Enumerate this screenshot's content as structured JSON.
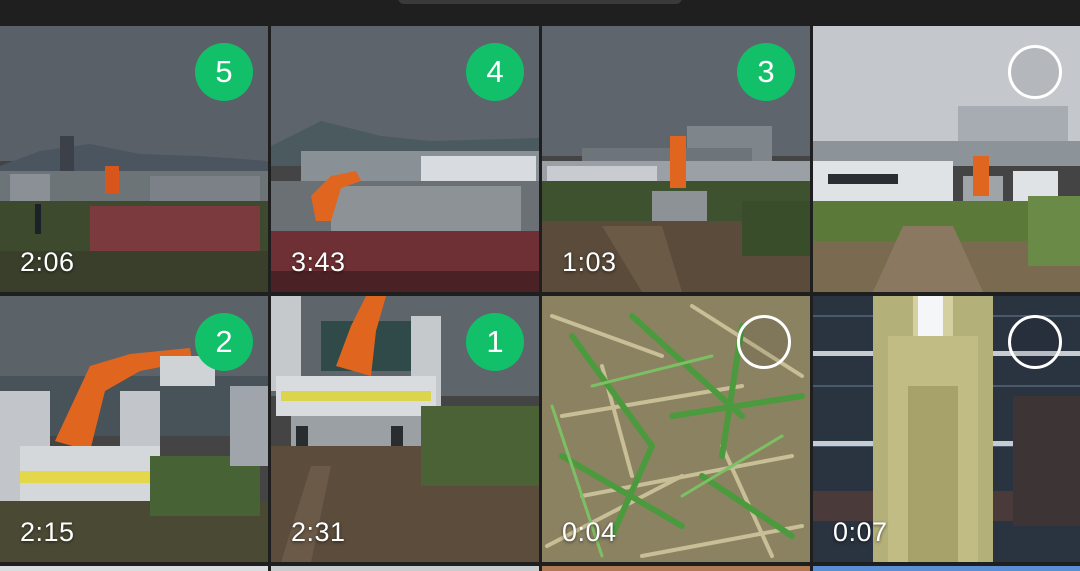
{
  "gallery": {
    "tiles": [
      {
        "duration": "2:06",
        "selection_order": "5",
        "selected": true
      },
      {
        "duration": "3:43",
        "selection_order": "4",
        "selected": true
      },
      {
        "duration": "1:03",
        "selection_order": "3",
        "selected": true
      },
      {
        "duration": "",
        "selection_order": "",
        "selected": false
      },
      {
        "duration": "2:15",
        "selection_order": "2",
        "selected": true
      },
      {
        "duration": "2:31",
        "selection_order": "1",
        "selected": true
      },
      {
        "duration": "0:04",
        "selection_order": "",
        "selected": false
      },
      {
        "duration": "0:07",
        "selection_order": "",
        "selected": false
      }
    ]
  },
  "colors": {
    "accent": "#12c06a",
    "background": "#1f1f1f"
  }
}
